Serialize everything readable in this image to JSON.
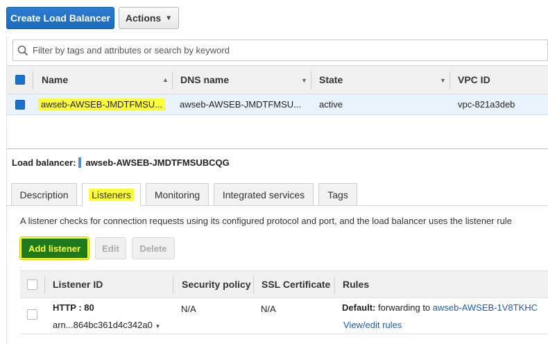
{
  "toolbar": {
    "create_label": "Create Load Balancer",
    "actions_label": "Actions"
  },
  "filter": {
    "placeholder": "Filter by tags and attributes or search by keyword"
  },
  "table": {
    "columns": [
      "Name",
      "DNS name",
      "State",
      "VPC ID"
    ],
    "rows": [
      {
        "name": "awseb-AWSEB-JMDTFMSU...",
        "dns": "awseb-AWSEB-JMDTFMSU...",
        "state": "active",
        "vpc": "vpc-821a3deb"
      }
    ]
  },
  "details": {
    "label": "Load balancer:",
    "name": "awseb-AWSEB-JMDTFMSUBCQG"
  },
  "tabs": [
    "Description",
    "Listeners",
    "Monitoring",
    "Integrated services",
    "Tags"
  ],
  "listeners": {
    "description": "A listener checks for connection requests using its configured protocol and port, and the load balancer uses the listener rule",
    "add_label": "Add listener",
    "edit_label": "Edit",
    "delete_label": "Delete",
    "columns": [
      "Listener ID",
      "Security policy",
      "SSL Certificate",
      "Rules"
    ],
    "rows": [
      {
        "id": "HTTP : 80",
        "arn": "arn...864bc361d4c342a0",
        "security_policy": "N/A",
        "ssl_certificate": "N/A",
        "rule_default": "Default:",
        "rule_text": "forwarding to",
        "rule_target": "awseb-AWSEB-1V8TKHC",
        "view_rules": "View/edit rules"
      }
    ]
  },
  "colors": {
    "primary": "#1b6bbf",
    "highlight": "#ffff3a",
    "add_button": "#1d7a1d",
    "link": "#1a5fae"
  }
}
